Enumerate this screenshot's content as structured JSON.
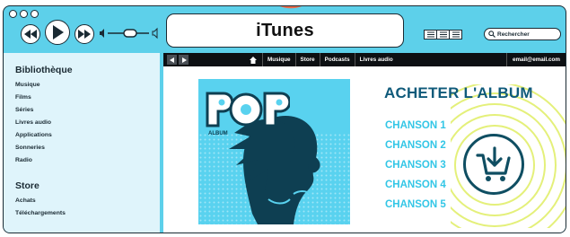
{
  "app": {
    "title": "iTunes"
  },
  "search": {
    "placeholder": "Rechercher"
  },
  "sidebar": {
    "library_heading": "Bibliothèque",
    "library_items": [
      "Musique",
      "Films",
      "Séries",
      "Livres audio",
      "Applications",
      "Sonneries",
      "Radio"
    ],
    "store_heading": "Store",
    "store_items": [
      "Achats",
      "Téléchargements"
    ]
  },
  "navbar": {
    "links": [
      "Musique",
      "Store",
      "Podcasts",
      "Livres audio"
    ],
    "account": "email@email.com"
  },
  "album": {
    "cover_title": "POP",
    "cover_subtitle": "ALBUM",
    "buy_heading": "ACHETER L'ALBUM",
    "tracks": [
      "CHANSON 1",
      "CHANSON 2",
      "CHANSON 3",
      "CHANSON 4",
      "CHANSON 5"
    ]
  },
  "colors": {
    "window": "#5dd0ea",
    "sidebar": "#dff4fb",
    "navbar": "#0d1013",
    "heading": "#0f5a7a",
    "track": "#33c6e6",
    "swirl": "#e4f07a"
  },
  "icons": {
    "transport": [
      "previous-icon",
      "play-icon",
      "next-icon"
    ],
    "volume": [
      "speaker-low-icon",
      "speaker-high-icon"
    ],
    "views": [
      "list-view-icon",
      "grid-view-icon",
      "coverflow-view-icon"
    ],
    "search": "search-icon",
    "nav": [
      "back-icon",
      "forward-icon",
      "home-icon"
    ],
    "buy": "download-cart-icon"
  }
}
